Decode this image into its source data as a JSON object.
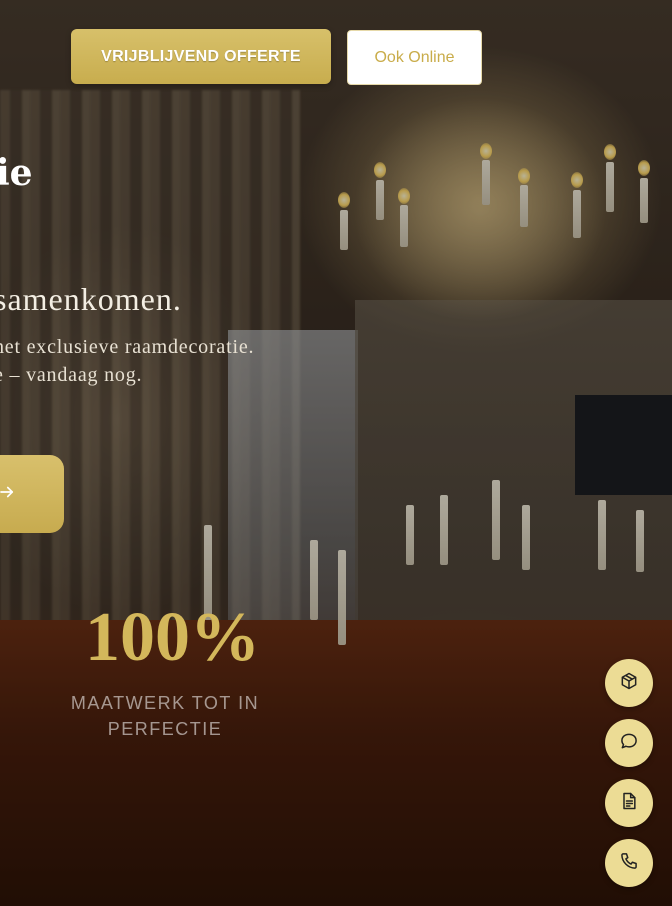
{
  "header": {
    "quote_button": "VRIJBLIJVEND OFFERTE",
    "online_button": "Ook Online"
  },
  "hero": {
    "brand_fragment": "ie",
    "headline": "samenkomen.",
    "subline_1": "het exclusieve raamdecoratie.",
    "subline_2": "e – vandaag nog."
  },
  "stat": {
    "value": "100%",
    "label_line_1": "MAATWERK TOT IN",
    "label_line_2": "PERFECTIE"
  },
  "fabs": [
    {
      "icon": "cube-icon"
    },
    {
      "icon": "chat-icon"
    },
    {
      "icon": "document-icon"
    },
    {
      "icon": "phone-icon"
    }
  ],
  "colors": {
    "accent_gold": "#c9ac4a",
    "fab_background": "#ecdc95"
  }
}
